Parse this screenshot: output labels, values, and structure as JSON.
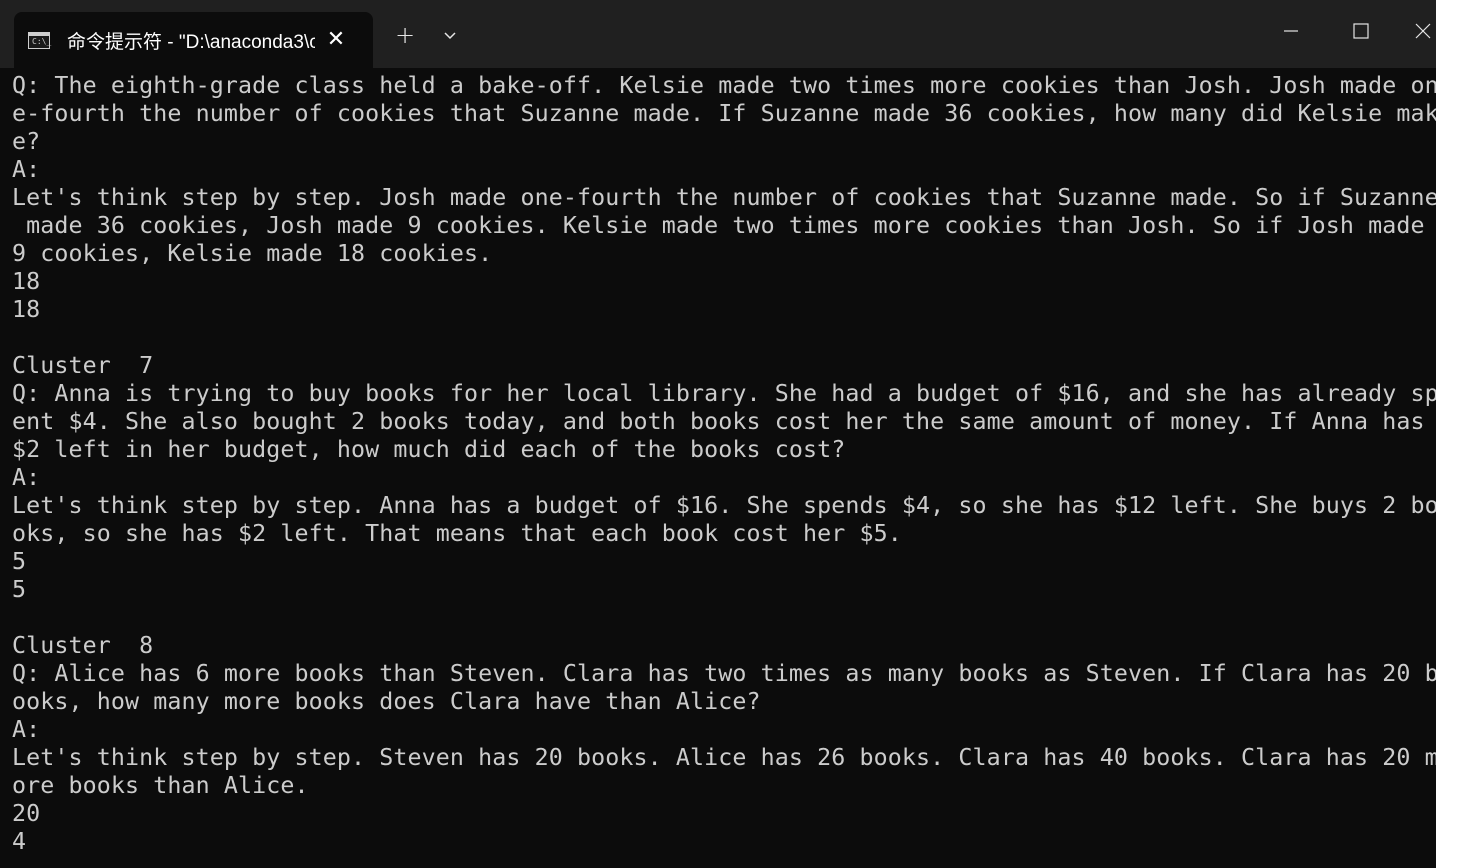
{
  "window": {
    "tab_title": "命令提示符 - \"D:\\anaconda3\\c",
    "tab_icon_glyph": "C:\\_",
    "new_tab_glyph": "+",
    "close_tab_glyph": "✕"
  },
  "console": {
    "lines": [
      "Q: The eighth-grade class held a bake-off. Kelsie made two times more cookies than Josh. Josh made on",
      "e-fourth the number of cookies that Suzanne made. If Suzanne made 36 cookies, how many did Kelsie mak",
      "e?",
      "A:",
      "Let's think step by step. Josh made one-fourth the number of cookies that Suzanne made. So if Suzanne",
      " made 36 cookies, Josh made 9 cookies. Kelsie made two times more cookies than Josh. So if Josh made",
      "9 cookies, Kelsie made 18 cookies.",
      "18",
      "18",
      "",
      "Cluster  7",
      "Q: Anna is trying to buy books for her local library. She had a budget of $16, and she has already sp",
      "ent $4. She also bought 2 books today, and both books cost her the same amount of money. If Anna has",
      "$2 left in her budget, how much did each of the books cost?",
      "A:",
      "Let's think step by step. Anna has a budget of $16. She spends $4, so she has $12 left. She buys 2 bo",
      "oks, so she has $2 left. That means that each book cost her $5.",
      "5",
      "5",
      "",
      "Cluster  8",
      "Q: Alice has 6 more books than Steven. Clara has two times as many books as Steven. If Clara has 20 b",
      "ooks, how many more books does Clara have than Alice?",
      "A:",
      "Let's think step by step. Steven has 20 books. Alice has 26 books. Clara has 40 books. Clara has 20 m",
      "ore books than Alice.",
      "20",
      "4"
    ]
  }
}
